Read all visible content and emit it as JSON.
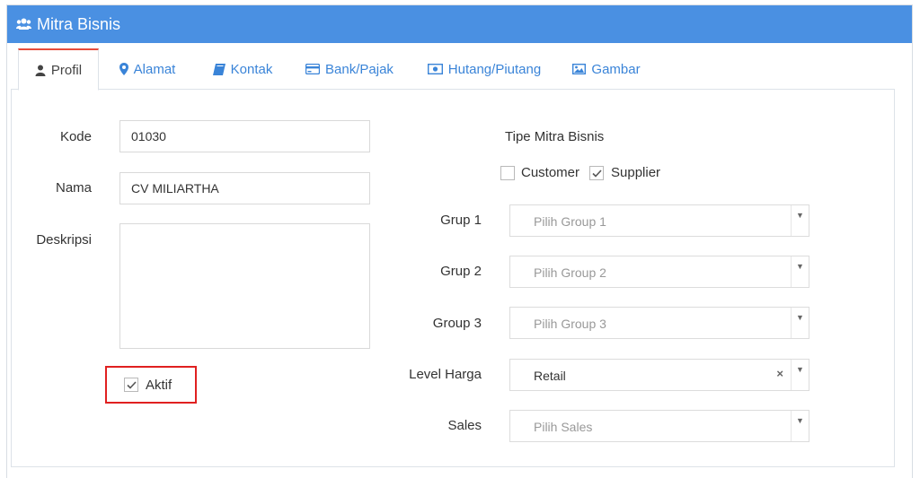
{
  "header": {
    "title": "Mitra Bisnis",
    "icon": "users-icon"
  },
  "tabs": [
    {
      "label": "Profil",
      "icon": "user-icon",
      "active": true
    },
    {
      "label": "Alamat",
      "icon": "map-marker-icon",
      "active": false
    },
    {
      "label": "Kontak",
      "icon": "book-icon",
      "active": false
    },
    {
      "label": "Bank/Pajak",
      "icon": "credit-card-icon",
      "active": false
    },
    {
      "label": "Hutang/Piutang",
      "icon": "money-icon",
      "active": false
    },
    {
      "label": "Gambar",
      "icon": "image-icon",
      "active": false
    }
  ],
  "form": {
    "kode": {
      "label": "Kode",
      "value": "01030"
    },
    "nama": {
      "label": "Nama",
      "value": "CV MILIARTHA"
    },
    "deskripsi": {
      "label": "Deskripsi",
      "value": ""
    },
    "aktif": {
      "label": "Aktif",
      "checked": true
    }
  },
  "tipe": {
    "label": "Tipe Mitra Bisnis",
    "customer": {
      "label": "Customer",
      "checked": false
    },
    "supplier": {
      "label": "Supplier",
      "checked": true
    }
  },
  "selects": {
    "group1": {
      "label": "Grup 1",
      "placeholder": "Pilih Group 1",
      "value": ""
    },
    "group2": {
      "label": "Grup 2",
      "placeholder": "Pilih Group 2",
      "value": ""
    },
    "group3": {
      "label": "Group 3",
      "placeholder": "Pilih Group 3",
      "value": ""
    },
    "level_harga": {
      "label": "Level Harga",
      "placeholder": "",
      "value": "Retail",
      "clear_glyph": "×"
    },
    "sales": {
      "label": "Sales",
      "placeholder": "Pilih Sales",
      "value": ""
    }
  },
  "colors": {
    "header_bg": "#4a90e2",
    "tab_link": "#3a84d8",
    "active_tab_accent": "#e74c3c",
    "highlight": "#e02020"
  }
}
